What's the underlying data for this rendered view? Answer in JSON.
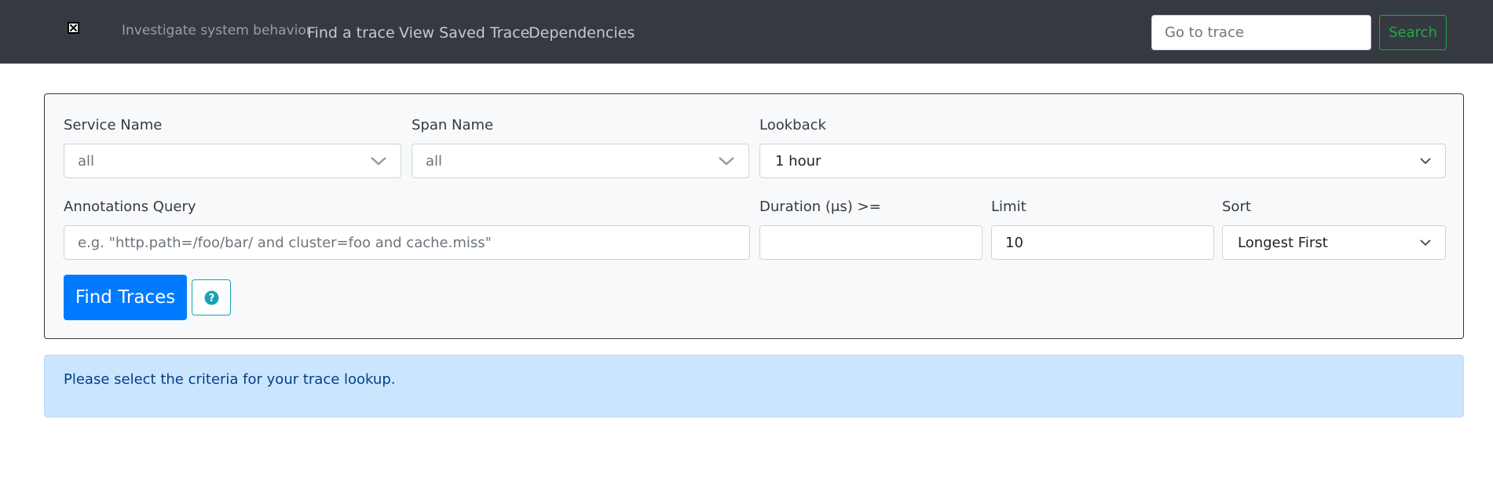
{
  "navbar": {
    "tagline": "Investigate system behavior",
    "links": [
      {
        "label": "Find a trace"
      },
      {
        "label": "View Saved Trace"
      },
      {
        "label": "Dependencies"
      }
    ],
    "goto_placeholder": "Go to trace",
    "search_label": "Search",
    "brand_icon": "broken-image-icon"
  },
  "form": {
    "service_name": {
      "label": "Service Name",
      "value": "all"
    },
    "span_name": {
      "label": "Span Name",
      "value": "all"
    },
    "lookback": {
      "label": "Lookback",
      "value": "1 hour"
    },
    "annotations": {
      "label": "Annotations Query",
      "placeholder": "e.g. \"http.path=/foo/bar/ and cluster=foo and cache.miss\""
    },
    "duration": {
      "label": "Duration (μs) >=",
      "value": ""
    },
    "limit": {
      "label": "Limit",
      "value": "10"
    },
    "sort": {
      "label": "Sort",
      "value": "Longest First"
    },
    "find_label": "Find Traces",
    "help_icon": "question-circle-icon"
  },
  "alert": {
    "message": "Please select the criteria for your trace lookup."
  },
  "colors": {
    "navbar_bg": "#343a40",
    "primary": "#007bff",
    "success": "#28a745",
    "info": "#17a2b8",
    "alert_bg": "#cce5ff",
    "alert_text": "#004085"
  }
}
